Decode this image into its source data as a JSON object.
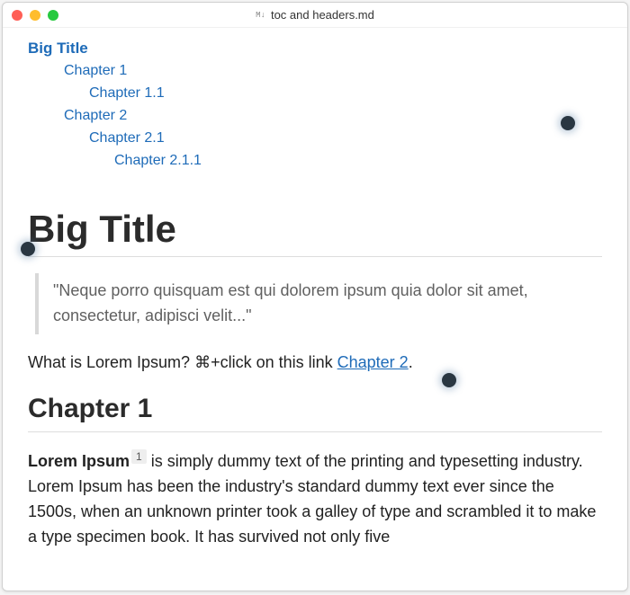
{
  "window": {
    "title": "toc and headers.md"
  },
  "toc": {
    "root": {
      "label": "Big Title"
    },
    "items": [
      {
        "label": "Chapter 1",
        "level": 1
      },
      {
        "label": "Chapter 1.1",
        "level": 2
      },
      {
        "label": "Chapter 2",
        "level": 1
      },
      {
        "label": "Chapter 2.1",
        "level": 2
      },
      {
        "label": "Chapter 2.1.1",
        "level": 3
      }
    ]
  },
  "doc": {
    "h1": "Big Title",
    "quote": "\"Neque porro quisquam est qui dolorem ipsum quia dolor sit amet, consectetur, adipisci velit...\"",
    "intro_prefix": "What is Lorem Ipsum? ⌘+click on this link ",
    "intro_link": "Chapter 2",
    "intro_suffix": ".",
    "chapter1_title": "Chapter 1",
    "para1_strong": "Lorem Ipsum",
    "footnote": "1",
    "para1_body": " is simply dummy text of the printing and typesetting industry. Lorem Ipsum has been the industry's standard dummy text ever since the 1500s, when an unknown printer took a galley of type and scrambled it to make a type specimen book. It has survived not only five"
  }
}
